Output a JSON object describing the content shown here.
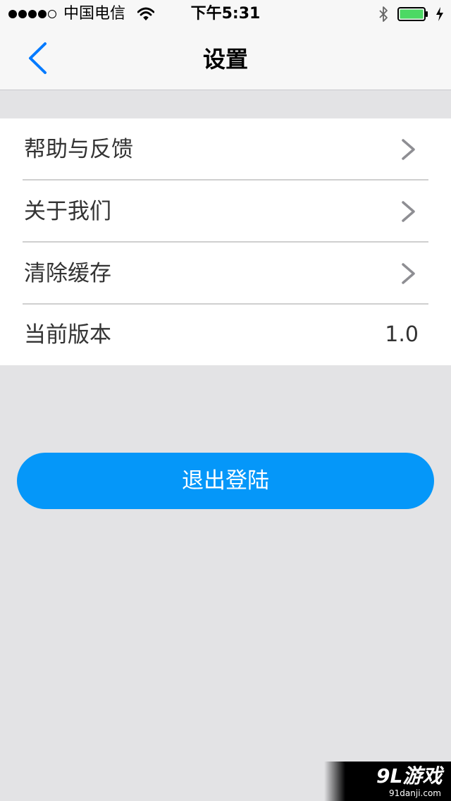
{
  "status_bar": {
    "carrier": "中国电信",
    "time": "下午5:31",
    "signal_bars_filled": 4,
    "signal_bars_total": 5,
    "battery_color": "#4cd964",
    "icons": [
      "signal-dots-icon",
      "wifi-icon",
      "bluetooth-icon",
      "battery-icon",
      "charging-icon"
    ]
  },
  "nav": {
    "title": "设置",
    "back_icon": "chevron-left-icon",
    "accent_color": "#007aff"
  },
  "settings": {
    "items": [
      {
        "label": "帮助与反馈",
        "icon": "chevron-right-icon"
      },
      {
        "label": "关于我们",
        "icon": "chevron-right-icon"
      },
      {
        "label": "清除缓存",
        "icon": "chevron-right-icon"
      },
      {
        "label": "当前版本",
        "value": "1.0"
      }
    ]
  },
  "logout": {
    "label": "退出登陆",
    "color": "#0597f9"
  },
  "watermark": {
    "logo": "9L游戏",
    "url": "91danji.com"
  }
}
